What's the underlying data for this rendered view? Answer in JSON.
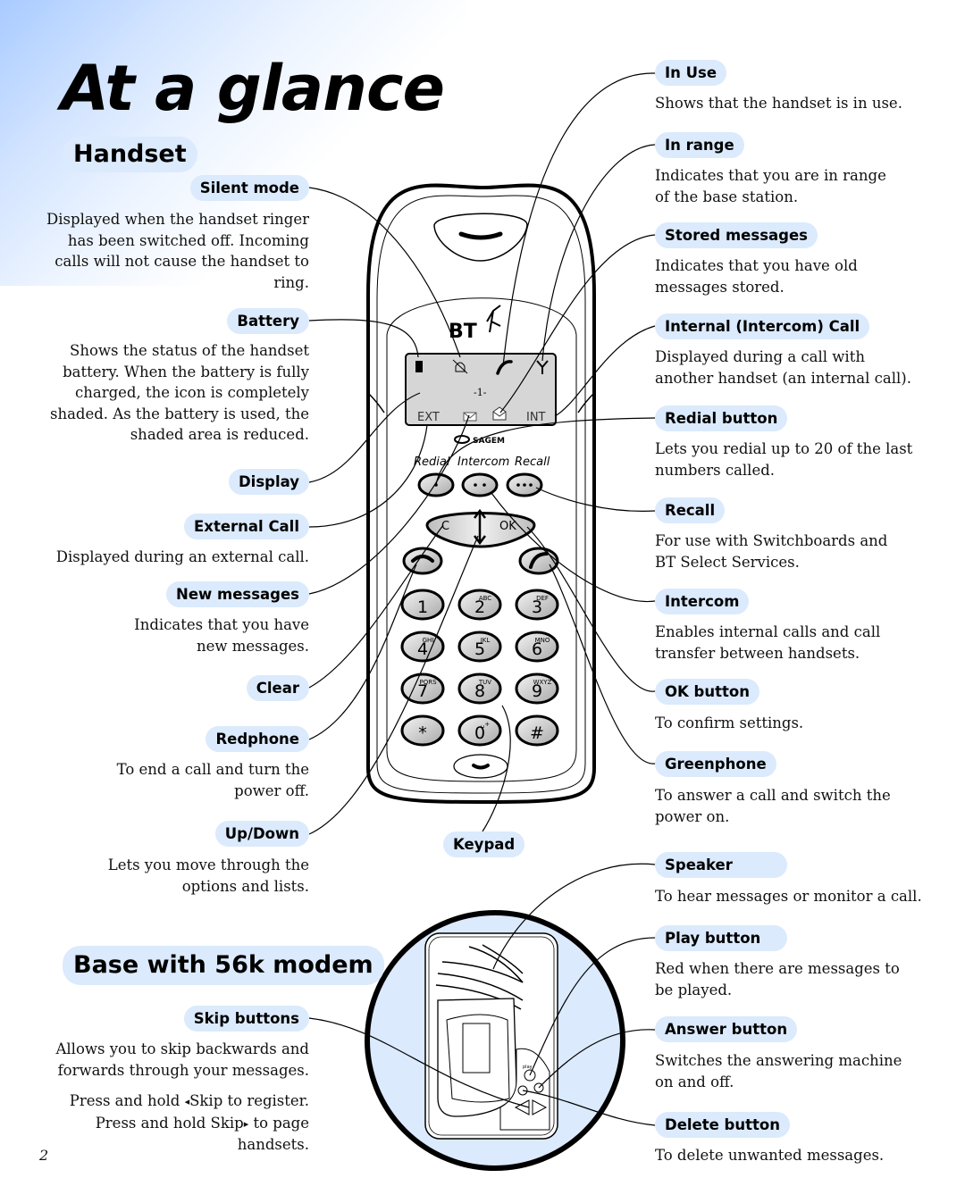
{
  "page": {
    "title": "At a glance",
    "page_number": "2"
  },
  "handset": {
    "heading": "Handset",
    "left_items": [
      {
        "label": "Silent mode",
        "desc": "Displayed when the handset ringer has been switched off. Incoming calls will not cause the handset to ring."
      },
      {
        "label": "Battery",
        "desc": "Shows the status of the handset battery. When the battery is fully charged, the icon is completely shaded. As the battery is used, the shaded area is reduced."
      },
      {
        "label": "Display",
        "desc": ""
      },
      {
        "label": "External Call",
        "desc": "Displayed during an external call."
      },
      {
        "label": "New messages",
        "desc": "Indicates that you have new messages."
      },
      {
        "label": "Clear",
        "desc": ""
      },
      {
        "label": "Redphone",
        "desc": "To end a call and turn the power off."
      },
      {
        "label": "Up/Down",
        "desc": "Lets you move through the options and lists."
      }
    ],
    "right_items": [
      {
        "label": "In Use",
        "desc": "Shows that the handset is in use."
      },
      {
        "label": "In range",
        "desc": "Indicates that you are in range of the base station."
      },
      {
        "label": "Stored messages",
        "desc": "Indicates that you have old messages stored."
      },
      {
        "label": "Internal (Intercom) Call",
        "desc": "Displayed during a call with another handset (an internal call)."
      },
      {
        "label": "Redial button",
        "desc": "Lets you redial up to 20 of the last numbers called."
      },
      {
        "label": "Recall",
        "desc": "For use with Switchboards and BT Select Services."
      },
      {
        "label": "Intercom",
        "desc": "Enables internal calls and call transfer between handsets."
      },
      {
        "label": "OK button",
        "desc": "To confirm settings."
      },
      {
        "label": "Greenphone",
        "desc": "To answer a call and switch the power on."
      }
    ],
    "keypad_label": "Keypad",
    "device": {
      "brand": "BT",
      "maker": "SAGEM",
      "screen": {
        "center_text": "-1-",
        "ext_label": "EXT",
        "int_label": "INT",
        "icons": [
          "battery-icon",
          "silent-bell-icon",
          "handset-icon",
          "antenna-icon",
          "envelope-icon",
          "open-envelope-icon"
        ]
      },
      "soft_key_labels": [
        "Redial",
        "Intercom",
        "Recall"
      ],
      "nav_keys": {
        "clear": "C",
        "ok": "OK"
      },
      "keys": [
        {
          "digit": "1",
          "letters": ""
        },
        {
          "digit": "2",
          "letters": "ABC"
        },
        {
          "digit": "3",
          "letters": "DEF"
        },
        {
          "digit": "4",
          "letters": "GHI"
        },
        {
          "digit": "5",
          "letters": "JKL"
        },
        {
          "digit": "6",
          "letters": "MNO"
        },
        {
          "digit": "7",
          "letters": "PQRS"
        },
        {
          "digit": "8",
          "letters": "TUV"
        },
        {
          "digit": "9",
          "letters": "WXYZ"
        },
        {
          "digit": "*",
          "letters": ""
        },
        {
          "digit": "0",
          "letters": "␣+"
        },
        {
          "digit": "#",
          "letters": ""
        }
      ]
    }
  },
  "base": {
    "heading": "Base with 56k modem",
    "left_items": [
      {
        "label": "Skip buttons",
        "desc": "Allows you to skip backwards and forwards through your messages.",
        "desc2_a": "Press and hold ",
        "desc2_tri_l": "◂",
        "desc2_b": "Skip to register.",
        "desc3_a": "Press and hold Skip",
        "desc3_tri_r": "▸",
        "desc3_b": " to page handsets."
      }
    ],
    "right_items": [
      {
        "label": "Speaker",
        "desc": "To hear messages or monitor a call."
      },
      {
        "label": "Play button",
        "desc": "Red when there are messages to be played."
      },
      {
        "label": "Answer button",
        "desc": "Switches the answering machine on and off."
      },
      {
        "label": "Delete button",
        "desc": "To delete unwanted messages."
      }
    ],
    "device": {
      "play_label": "play"
    }
  },
  "colors": {
    "pill_bg": "#dbeafc",
    "base_circle_bg": "#dbeafc",
    "gradient_corner": "#a9cbff",
    "screen_bg": "#d6d6d6"
  }
}
